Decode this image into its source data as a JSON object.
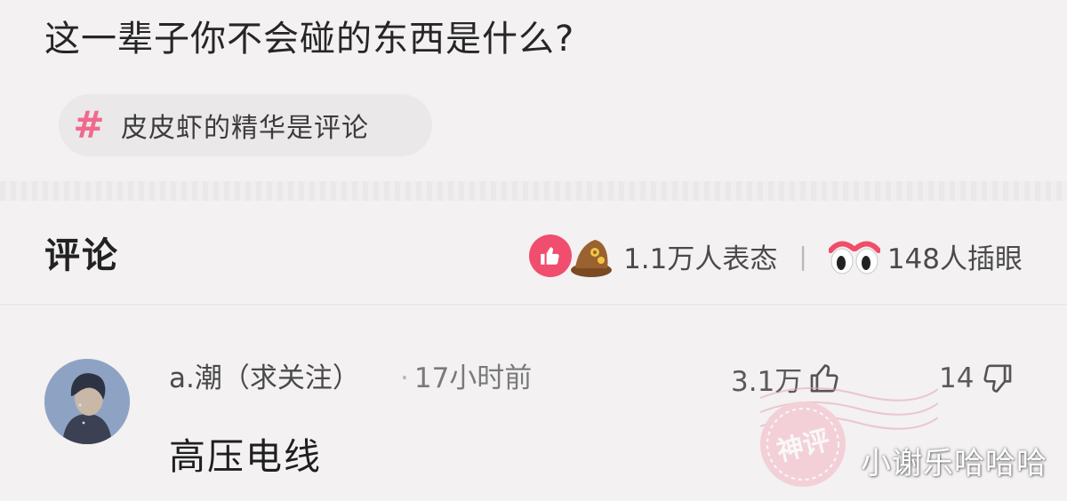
{
  "post": {
    "title": "这一辈子你不会碰的东西是什么?",
    "topic": "皮皮虾的精华是评论",
    "topic_icon": "hashtag-icon"
  },
  "comments_section": {
    "heading": "评论",
    "reactions_text": "1.1万人表态",
    "separator": "|",
    "eye_text": "148人插眼"
  },
  "comment": {
    "author": "a.潮（求关注）",
    "time": "17小时前",
    "likes": "3.1万",
    "dislikes": "14",
    "body": "高压电线",
    "stamp_label": "神评"
  },
  "watermark": "小谢乐哈哈哈",
  "colors": {
    "background": "#f3f1f1",
    "accent_pink": "#f06a8e",
    "like_red": "#f14d6f"
  }
}
